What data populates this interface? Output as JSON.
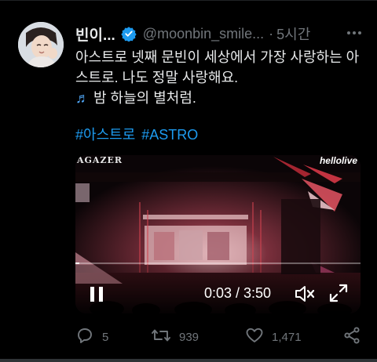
{
  "tweet": {
    "display_name": "빈이...",
    "handle": "@moonbin_smile...",
    "separator": "·",
    "time": "5시간",
    "text_line1": "아스트로 넷째 문빈이 세상에서 가장 사랑하는 아",
    "text_line2": "스트로. 나도 정말 사랑해요.",
    "text_line3": "밤 하늘의 별처럼.",
    "hashtags": [
      "#아스트로",
      "#ASTRO"
    ]
  },
  "video": {
    "watermark_left": "AGAZER",
    "watermark_right": "hellolive",
    "current_time": "0:03",
    "duration": "3:50",
    "time_display": "0:03 / 3:50",
    "progress_fraction": 0.013
  },
  "actions": {
    "replies": "5",
    "retweets": "939",
    "likes": "1,471"
  },
  "colors": {
    "background": "#000000",
    "text": "#e7e9ea",
    "muted": "#71767b",
    "accent": "#1d9bf0"
  },
  "icons": {
    "verified": "verified-badge-icon",
    "more": "more-options-icon",
    "music": "music-note-icon",
    "pause": "pause-icon",
    "mute": "mute-icon",
    "fullscreen": "fullscreen-icon",
    "reply": "reply-icon",
    "retweet": "retweet-icon",
    "like": "heart-icon",
    "share": "share-icon"
  }
}
